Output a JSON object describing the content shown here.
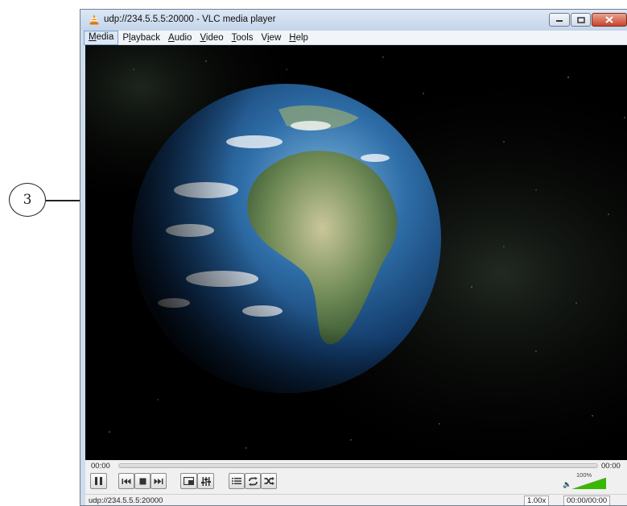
{
  "window": {
    "title": "udp://234.5.5.5:20000 - VLC media player"
  },
  "callout": {
    "number": "3"
  },
  "menu": {
    "items": [
      {
        "label": "Media",
        "active": true
      },
      {
        "label": "Playback"
      },
      {
        "label": "Audio"
      },
      {
        "label": "Video"
      },
      {
        "label": "Tools"
      },
      {
        "label": "View"
      },
      {
        "label": "Help"
      }
    ]
  },
  "controls": {
    "elapsed": "00:00",
    "total": "00:00",
    "volume_label": "100%",
    "volume_level": 1.0,
    "seek_progress": 0
  },
  "status": {
    "url": "udp://234.5.5.5:20000",
    "rate": "1.00x",
    "time": "00:00/00:00"
  },
  "icons": {
    "app": "vlc-cone-icon",
    "minimize": "minimize-icon",
    "maximize": "maximize-icon",
    "close": "close-icon",
    "pause": "pause-icon",
    "previous": "previous-icon",
    "stop": "stop-icon",
    "next": "next-icon",
    "fullscreen": "fullscreen-icon",
    "extended": "extended-settings-icon",
    "playlist": "playlist-icon",
    "loop": "loop-icon",
    "shuffle": "shuffle-icon",
    "volume": "speaker-icon"
  },
  "colors": {
    "titlebar": "#cfdcec",
    "close_button": "#c9452c",
    "video_background": "#000000",
    "volume_fill": "#38b800"
  }
}
